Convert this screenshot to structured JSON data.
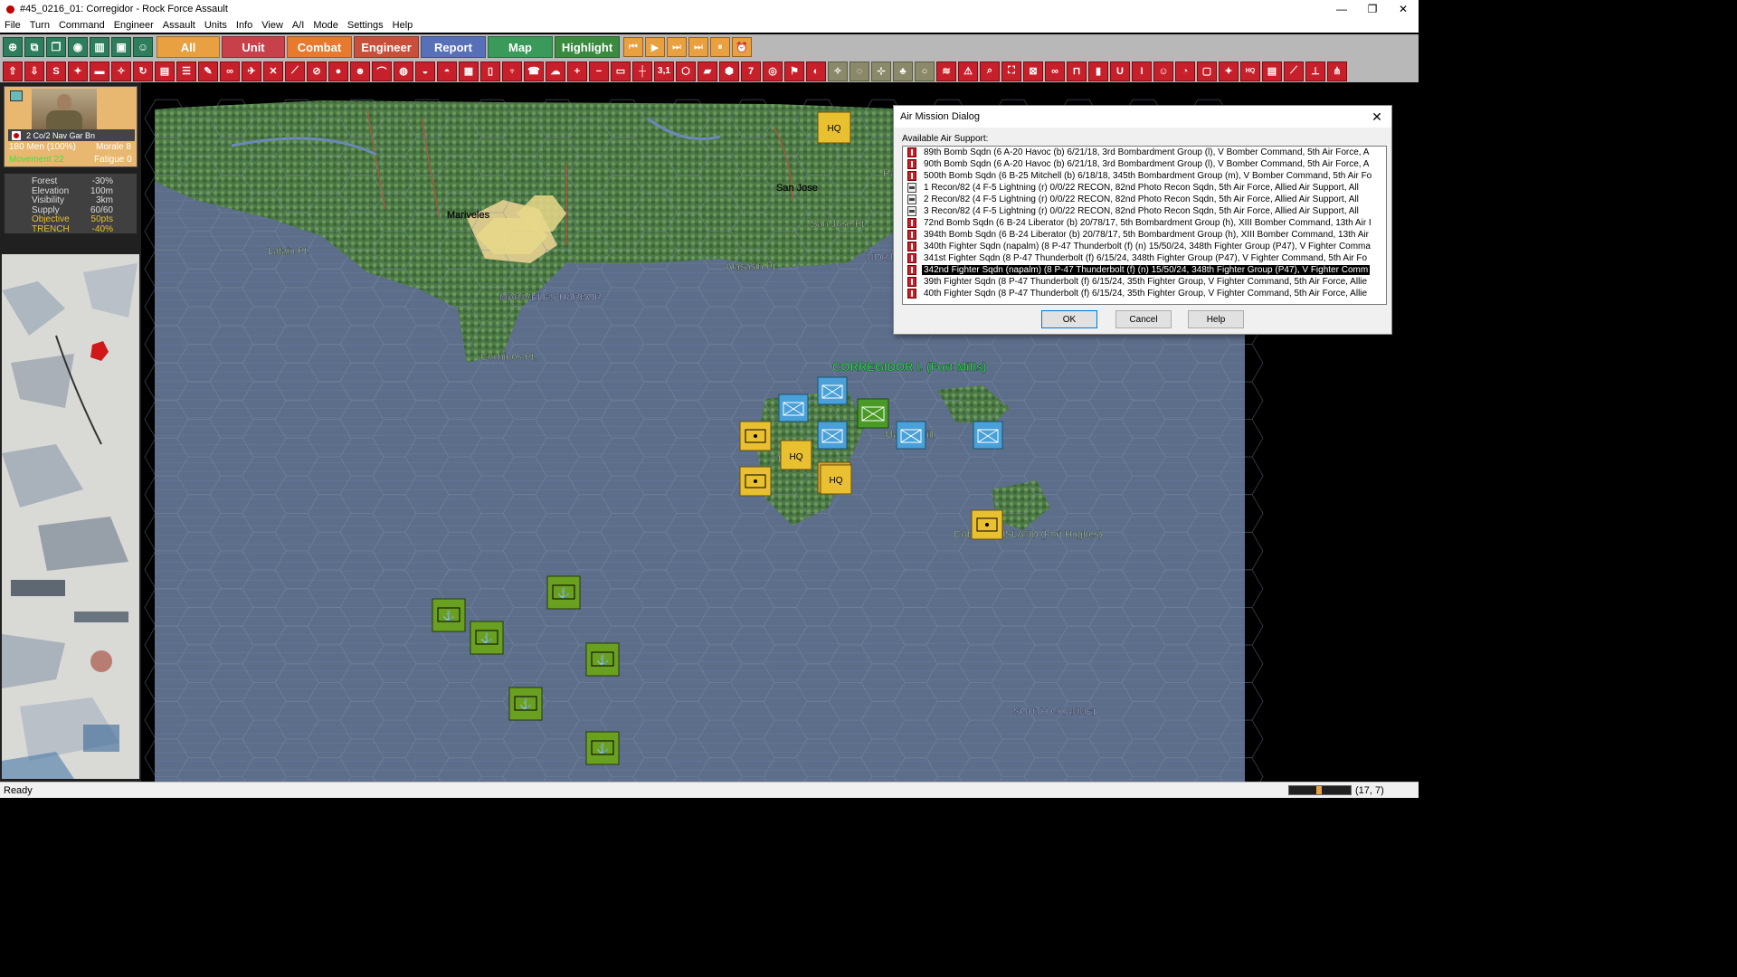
{
  "window": {
    "title": "#45_0216_01: Corregidor - Rock Force Assault",
    "minimize": "—",
    "maximize": "❐",
    "close": "✕"
  },
  "menu": [
    "File",
    "Turn",
    "Command",
    "Engineer",
    "Assault",
    "Units",
    "Info",
    "View",
    "A/I",
    "Mode",
    "Settings",
    "Help"
  ],
  "toolbar1": {
    "tabs": [
      {
        "label": "All",
        "color": "#e8a040"
      },
      {
        "label": "Unit",
        "color": "#c8404a"
      },
      {
        "label": "Combat",
        "color": "#e87a30"
      },
      {
        "label": "Engineer",
        "color": "#c8503a"
      },
      {
        "label": "Report",
        "color": "#5870b8"
      },
      {
        "label": "Map",
        "color": "#3a9a5a"
      },
      {
        "label": "Highlight",
        "color": "#3a8a40"
      }
    ]
  },
  "toolbar2": {
    "zoom_value": "3,1",
    "seven": "7"
  },
  "unit_panel": {
    "unit_name": "2 Co/2 Nav Gar Bn",
    "men": "180 Men (100%)",
    "morale": "Morale 8",
    "movement": "Movement 22",
    "fatigue": "Fatigue 0"
  },
  "terrain": [
    {
      "k": "Forest",
      "v": "-30%",
      "color": "#dddddd"
    },
    {
      "k": "Elevation",
      "v": "100m",
      "color": "#dddddd"
    },
    {
      "k": "Visibility",
      "v": "3km",
      "color": "#dddddd"
    },
    {
      "k": "Supply",
      "v": "60/60",
      "color": "#dddddd"
    },
    {
      "k": "Objective",
      "v": "50pts",
      "color": "#e8c030"
    },
    {
      "k": "TRENCH",
      "v": "-40%",
      "color": "#e8c030"
    }
  ],
  "map_labels": [
    {
      "id": "mariveles",
      "text": "Mariveles",
      "color": "#101010"
    },
    {
      "id": "latain",
      "text": "Latain Pt.",
      "color": "#c8e8c0"
    },
    {
      "id": "mariveles-harbor",
      "text": "MARIVELES HARBOR",
      "color": "#c0c8f8"
    },
    {
      "id": "cochinos",
      "text": "Cochinos Pt.",
      "color": "#c8e8c0"
    },
    {
      "id": "san-jose",
      "text": "San Jose",
      "color": "#101010"
    },
    {
      "id": "san-jose-pt",
      "text": "San Jose Pt.",
      "color": "#c8e8c0"
    },
    {
      "id": "alasasin",
      "text": "Alasasin Pt.",
      "color": "#c8e8c0"
    },
    {
      "id": "nort",
      "text": "NORT",
      "color": "#c0c8f8"
    },
    {
      "id": "ra",
      "text": "Ra",
      "color": "#c8e8c0"
    },
    {
      "id": "corregidor",
      "text": "CORREGIDOR I. (Fort Mills)",
      "color": "#30d050"
    },
    {
      "id": "malinta",
      "text": "Malinta Hill",
      "color": "#c8e8c0"
    },
    {
      "id": "topside",
      "text": "Topside",
      "color": "#c8e8c0"
    },
    {
      "id": "caballo",
      "text": "CABALLO ISLAND (Fort Hughes)",
      "color": "#c8e8c0"
    },
    {
      "id": "south-channel",
      "text": "SOUTH CHANNEL",
      "color": "#c0c8f8"
    }
  ],
  "counters": {
    "hq": "HQ"
  },
  "dialog": {
    "title": "Air Mission Dialog",
    "label": "Available Air Support:",
    "items": [
      {
        "text": "89th Bomb Sqdn (6 A-20 Havoc (b) 6/21/18, 3rd Bombardment Group (l), V Bomber Command, 5th Air Force, A",
        "type": "bomb"
      },
      {
        "text": "90th Bomb Sqdn (6 A-20 Havoc (b) 6/21/18, 3rd Bombardment Group (l), V Bomber Command, 5th Air Force, A",
        "type": "bomb"
      },
      {
        "text": "500th Bomb Sqdn (6 B-25 Mitchell (b) 6/18/18, 345th Bombardment Group (m), V Bomber Command, 5th Air Fo",
        "type": "bomb"
      },
      {
        "text": "1 Recon/82 (4 F-5 Lightning (r) 0/0/22 RECON, 82nd Photo Recon Sqdn, 5th Air Force, Allied Air Support, All",
        "type": "recon"
      },
      {
        "text": "2 Recon/82 (4 F-5 Lightning (r) 0/0/22 RECON, 82nd Photo Recon Sqdn, 5th Air Force, Allied Air Support, All",
        "type": "recon"
      },
      {
        "text": "3 Recon/82 (4 F-5 Lightning (r) 0/0/22 RECON, 82nd Photo Recon Sqdn, 5th Air Force, Allied Air Support, All",
        "type": "recon"
      },
      {
        "text": "72nd Bomb Sqdn (6 B-24 Liberator (b) 20/78/17, 5th Bombardment Group (h), XIII Bomber Command, 13th Air I",
        "type": "bomb"
      },
      {
        "text": "394th Bomb Sqdn (6 B-24 Liberator (b) 20/78/17, 5th Bombardment Group (h), XIII Bomber Command, 13th Air",
        "type": "bomb"
      },
      {
        "text": "340th Fighter Sqdn (napalm) (8 P-47 Thunderbolt (f) (n) 15/50/24, 348th Fighter Group (P47), V Fighter Comma",
        "type": "bomb"
      },
      {
        "text": "341st Fighter Sqdn (8 P-47 Thunderbolt (f) 6/15/24, 348th Fighter Group (P47), V Fighter Command, 5th Air Fo",
        "type": "bomb"
      },
      {
        "text": "342nd Fighter Sqdn (napalm) (8 P-47 Thunderbolt (f) (n) 15/50/24, 348th Fighter Group (P47), V Fighter Comm",
        "type": "bomb",
        "selected": true
      },
      {
        "text": "39th Fighter Sqdn (8 P-47 Thunderbolt (f) 6/15/24, 35th Fighter Group, V Fighter Command, 5th Air Force, Allie",
        "type": "bomb"
      },
      {
        "text": "40th Fighter Sqdn (8 P-47 Thunderbolt (f) 6/15/24, 35th Fighter Group, V Fighter Command, 5th Air Force, Allie",
        "type": "bomb"
      }
    ],
    "ok": "OK",
    "cancel": "Cancel",
    "help": "Help"
  },
  "status": {
    "text": "Ready",
    "coords": "(17, 7)"
  }
}
